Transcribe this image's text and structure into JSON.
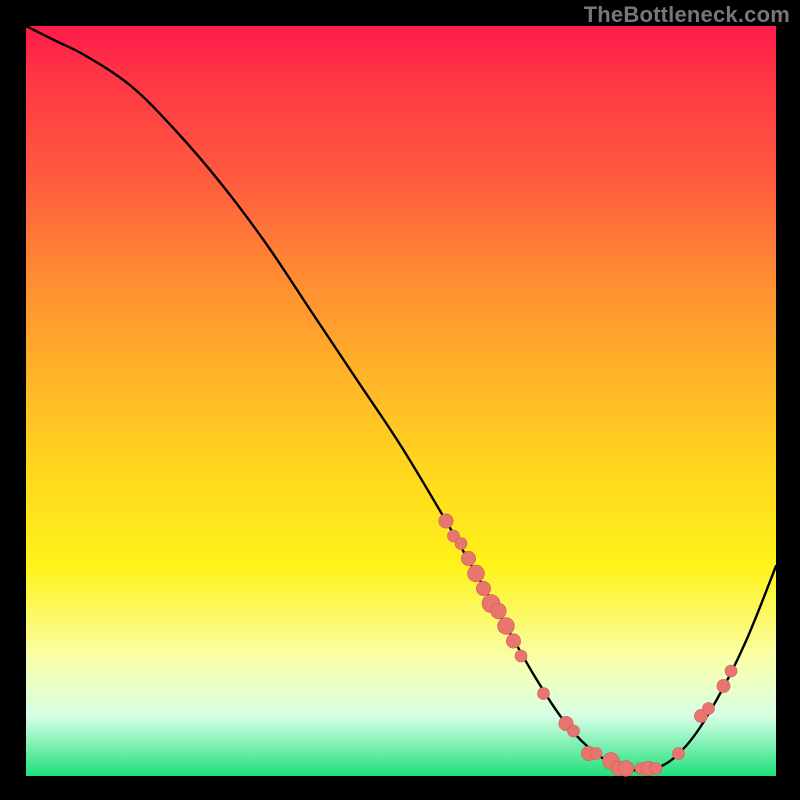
{
  "watermark": "TheBottleneck.com",
  "colors": {
    "curve": "#000000",
    "marker": "#e9766e",
    "marker_stroke": "#c95f58",
    "page_bg": "#000000"
  },
  "chart_data": {
    "type": "line",
    "title": "",
    "xlabel": "",
    "ylabel": "",
    "xlim": [
      0,
      100
    ],
    "ylim": [
      0,
      100
    ],
    "series": [
      {
        "name": "bottleneck-curve",
        "x": [
          0,
          4,
          8,
          14,
          20,
          26,
          32,
          38,
          44,
          50,
          56,
          60,
          64,
          68,
          72,
          76,
          80,
          84,
          88,
          92,
          96,
          100
        ],
        "y": [
          100,
          98,
          96,
          92,
          86,
          79,
          71,
          62,
          53,
          44,
          34,
          27,
          20,
          13,
          7,
          3,
          1,
          1,
          4,
          10,
          18,
          28
        ]
      }
    ],
    "markers": [
      {
        "x": 56,
        "y": 34,
        "r": 1.2
      },
      {
        "x": 57,
        "y": 32,
        "r": 1.0
      },
      {
        "x": 58,
        "y": 31,
        "r": 1.0
      },
      {
        "x": 59,
        "y": 29,
        "r": 1.2
      },
      {
        "x": 60,
        "y": 27,
        "r": 1.4
      },
      {
        "x": 61,
        "y": 25,
        "r": 1.2
      },
      {
        "x": 62,
        "y": 23,
        "r": 1.5
      },
      {
        "x": 63,
        "y": 22,
        "r": 1.3
      },
      {
        "x": 64,
        "y": 20,
        "r": 1.4
      },
      {
        "x": 65,
        "y": 18,
        "r": 1.2
      },
      {
        "x": 66,
        "y": 16,
        "r": 1.0
      },
      {
        "x": 69,
        "y": 11,
        "r": 1.0
      },
      {
        "x": 72,
        "y": 7,
        "r": 1.2
      },
      {
        "x": 73,
        "y": 6,
        "r": 1.0
      },
      {
        "x": 75,
        "y": 3,
        "r": 1.2
      },
      {
        "x": 76,
        "y": 3,
        "r": 1.0
      },
      {
        "x": 78,
        "y": 2,
        "r": 1.4
      },
      {
        "x": 79,
        "y": 1,
        "r": 1.2
      },
      {
        "x": 80,
        "y": 1,
        "r": 1.3
      },
      {
        "x": 82,
        "y": 1,
        "r": 1.0
      },
      {
        "x": 83,
        "y": 1,
        "r": 1.2
      },
      {
        "x": 84,
        "y": 1,
        "r": 1.0
      },
      {
        "x": 87,
        "y": 3,
        "r": 1.0
      },
      {
        "x": 90,
        "y": 8,
        "r": 1.1
      },
      {
        "x": 91,
        "y": 9,
        "r": 1.0
      },
      {
        "x": 93,
        "y": 12,
        "r": 1.1
      },
      {
        "x": 94,
        "y": 14,
        "r": 1.0
      }
    ]
  }
}
